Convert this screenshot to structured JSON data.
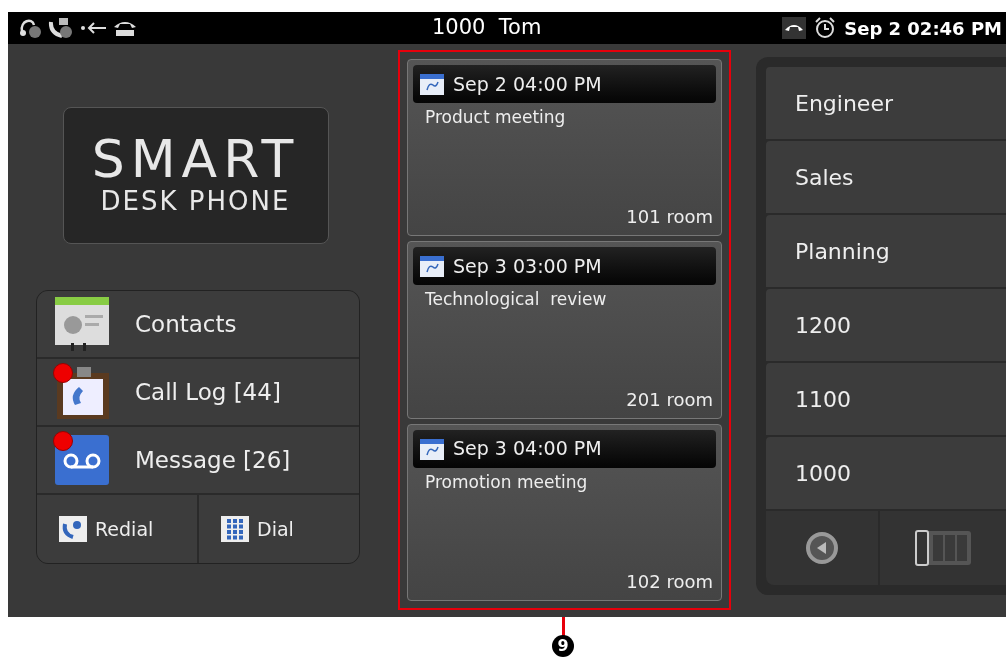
{
  "status_bar": {
    "title": "1000  Tom",
    "clock": "Sep 2 02:46 PM"
  },
  "logo": {
    "line1": "SMART",
    "line2": "DESK PHONE"
  },
  "menu": [
    {
      "kind": "contacts",
      "label": "Contacts",
      "unread": false
    },
    {
      "kind": "calllog",
      "label": "Call Log [44]",
      "unread": true
    },
    {
      "kind": "message",
      "label": "Message [26]",
      "unread": true
    }
  ],
  "actions": [
    {
      "kind": "redial",
      "label": "Redial"
    },
    {
      "kind": "dial",
      "label": "Dial"
    }
  ],
  "events": [
    {
      "time": "Sep 2 04:00 PM",
      "title": "Product meeting",
      "room": "101 room"
    },
    {
      "time": "Sep 3 03:00 PM",
      "title": "Technological  review",
      "room": "201 room"
    },
    {
      "time": "Sep 3 04:00 PM",
      "title": "Promotion meeting",
      "room": "102 room"
    }
  ],
  "speed_dial": [
    "Engineer",
    "Sales",
    "Planning",
    "1200",
    "1100",
    "1000"
  ],
  "callout": {
    "label": "9"
  }
}
